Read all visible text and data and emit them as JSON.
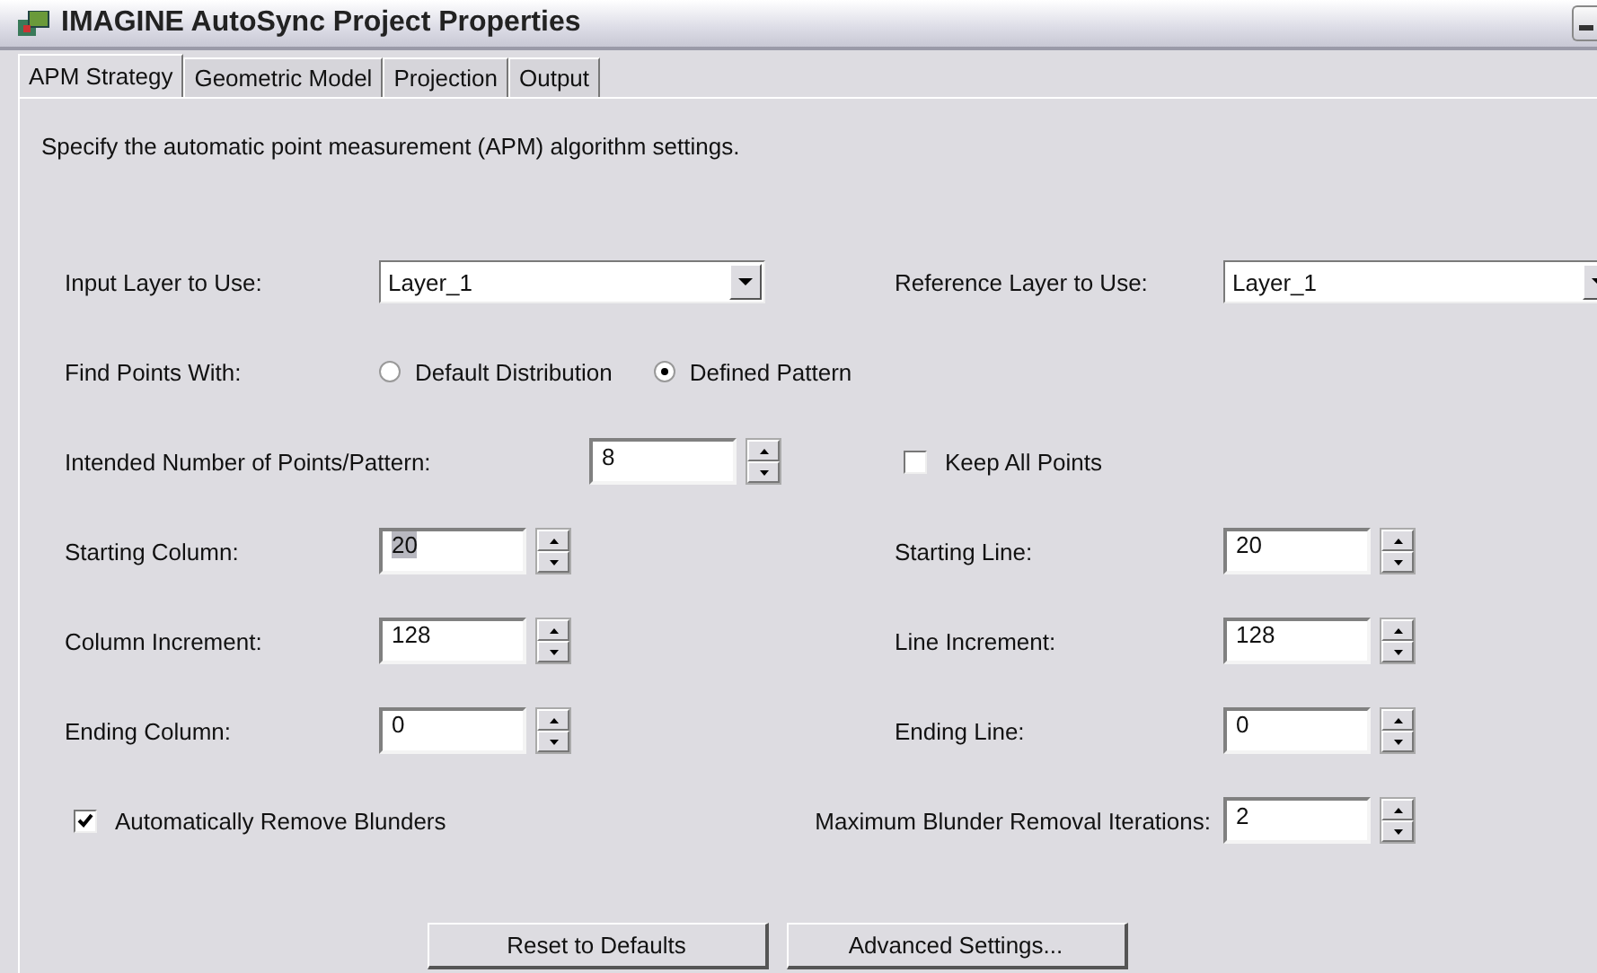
{
  "window": {
    "title": "IMAGINE AutoSync Project Properties"
  },
  "tabs": [
    {
      "label": "APM Strategy",
      "selected": true
    },
    {
      "label": "Geometric Model",
      "selected": false
    },
    {
      "label": "Projection",
      "selected": false
    },
    {
      "label": "Output",
      "selected": false
    }
  ],
  "description": "Specify the automatic point measurement (APM) algorithm settings.",
  "input_layer": {
    "label": "Input Layer to Use:",
    "value": "Layer_1"
  },
  "reference_layer": {
    "label": "Reference Layer to Use:",
    "value": "Layer_1"
  },
  "find_points": {
    "label": "Find Points With:",
    "options": [
      {
        "label": "Default Distribution",
        "selected": false
      },
      {
        "label": "Defined Pattern",
        "selected": true
      }
    ]
  },
  "points_per_pattern": {
    "label": "Intended Number of Points/Pattern:",
    "value": "8"
  },
  "keep_all_points": {
    "label": "Keep All Points",
    "checked": false
  },
  "spin_rows": [
    [
      {
        "label": "Starting Column:",
        "value": "20",
        "value_selected": true
      },
      {
        "label": "Starting Line:",
        "value": "20",
        "value_selected": false
      }
    ],
    [
      {
        "label": "Column Increment:",
        "value": "128",
        "value_selected": false
      },
      {
        "label": "Line Increment:",
        "value": "128",
        "value_selected": false
      }
    ],
    [
      {
        "label": "Ending Column:",
        "value": "0",
        "value_selected": false
      },
      {
        "label": "Ending Line:",
        "value": "0",
        "value_selected": false
      }
    ]
  ],
  "auto_remove": {
    "label": "Automatically Remove Blunders",
    "checked": true
  },
  "max_iterations": {
    "label": "Maximum Blunder Removal Iterations:",
    "value": "2"
  },
  "buttons": [
    "Reset to Defaults",
    "Advanced Settings..."
  ]
}
